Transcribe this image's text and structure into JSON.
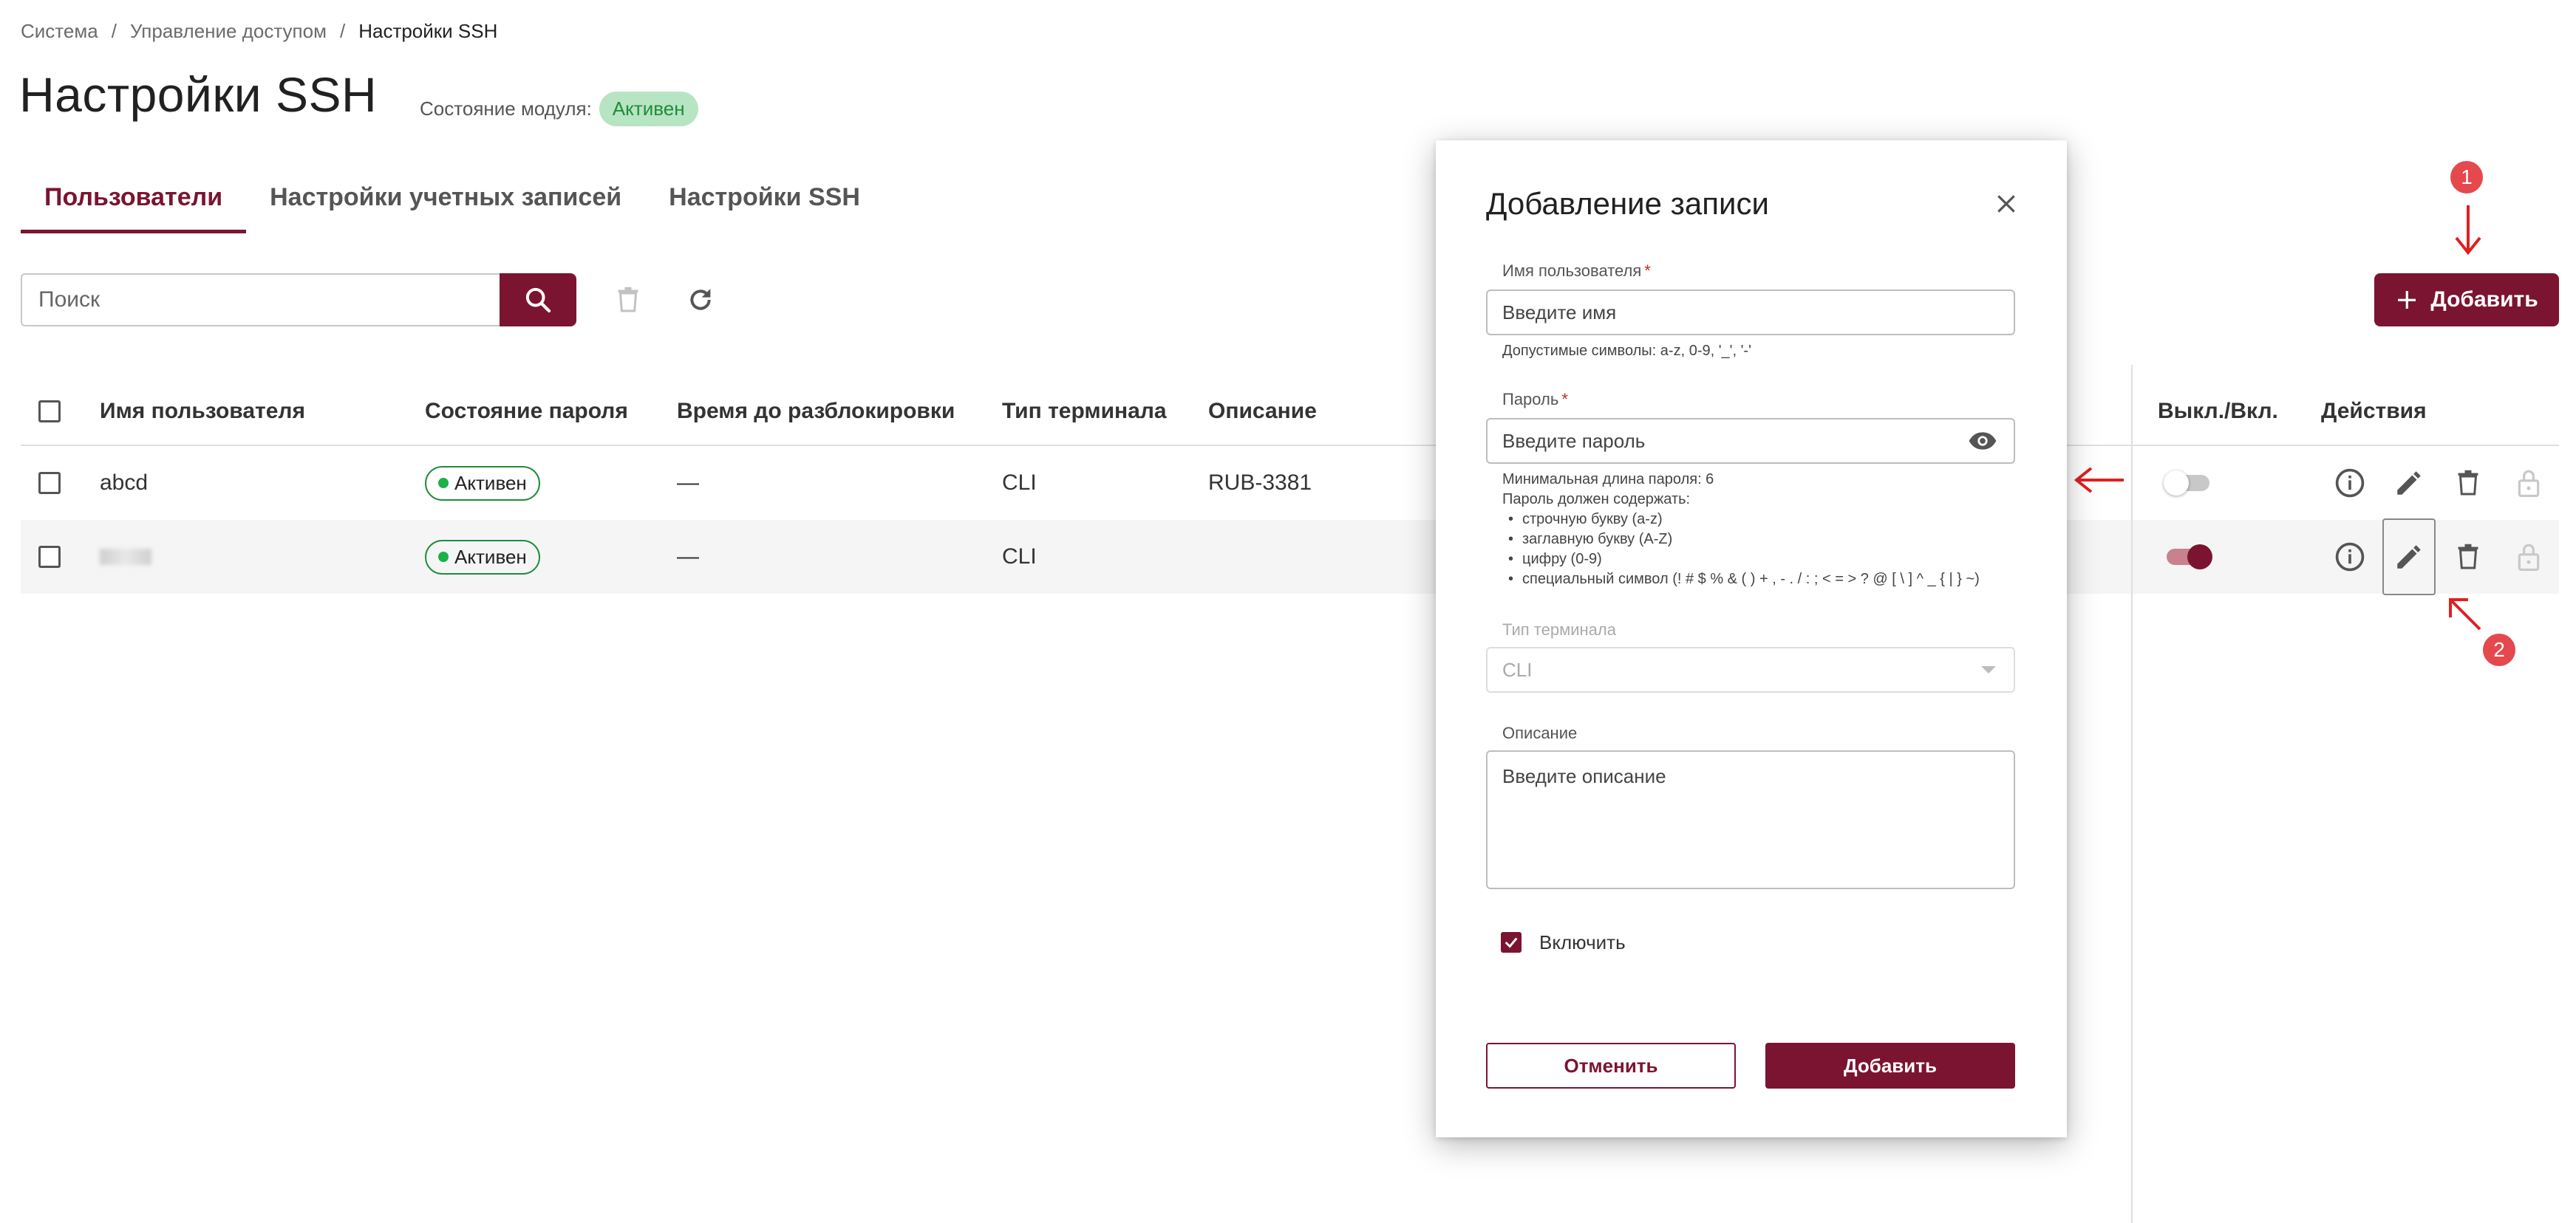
{
  "breadcrumb": [
    "Система",
    "Управление доступом",
    "Настройки SSH"
  ],
  "header": {
    "title": "Настройки SSH",
    "module_state_label": "Состояние модуля:",
    "module_state_value": "Активен"
  },
  "tabs": [
    {
      "label": "Пользователи",
      "active": true
    },
    {
      "label": "Настройки учетных записей",
      "active": false
    },
    {
      "label": "Настройки SSH",
      "active": false
    }
  ],
  "toolbar": {
    "search_placeholder": "Поиск",
    "add_label": "Добавить"
  },
  "table": {
    "columns": [
      "Имя пользователя",
      "Состояние пароля",
      "Время до разблокировки",
      "Тип терминала",
      "Описание",
      "Выкл./Вкл.",
      "Действия"
    ],
    "rows": [
      {
        "username": "abcd",
        "password_state": "Активен",
        "unlock_time": "—",
        "terminal": "CLI",
        "description": "RUB-3381",
        "enabled": false
      },
      {
        "username": "",
        "password_state": "Активен",
        "unlock_time": "—",
        "terminal": "CLI",
        "description": "",
        "enabled": true
      }
    ]
  },
  "annotations": {
    "step1": "1",
    "step2": "2"
  },
  "modal": {
    "title": "Добавление записи",
    "username_label": "Имя пользователя",
    "username_placeholder": "Введите имя",
    "username_hint": "Допустимые символы: a-z, 0-9, '_', '-'",
    "password_label": "Пароль",
    "password_placeholder": "Введите пароль",
    "password_hint_min": "Минимальная длина пароля: 6",
    "password_hint_must": "Пароль должен содержать:",
    "password_rules": [
      "строчную букву (a-z)",
      "заглавную букву (A-Z)",
      "цифру (0-9)",
      "специальный символ (! # $ % & ( ) + , - . / : ; < = > ? @ [ \\ ] ^ _ { | } ~)"
    ],
    "terminal_label": "Тип терминала",
    "terminal_value": "CLI",
    "description_label": "Описание",
    "description_placeholder": "Введите описание",
    "enable_label": "Включить",
    "cancel_label": "Отменить",
    "submit_label": "Добавить"
  },
  "colors": {
    "accent": "#7b1430",
    "annotation": "#e5484d",
    "status_green": "#1eb048"
  }
}
